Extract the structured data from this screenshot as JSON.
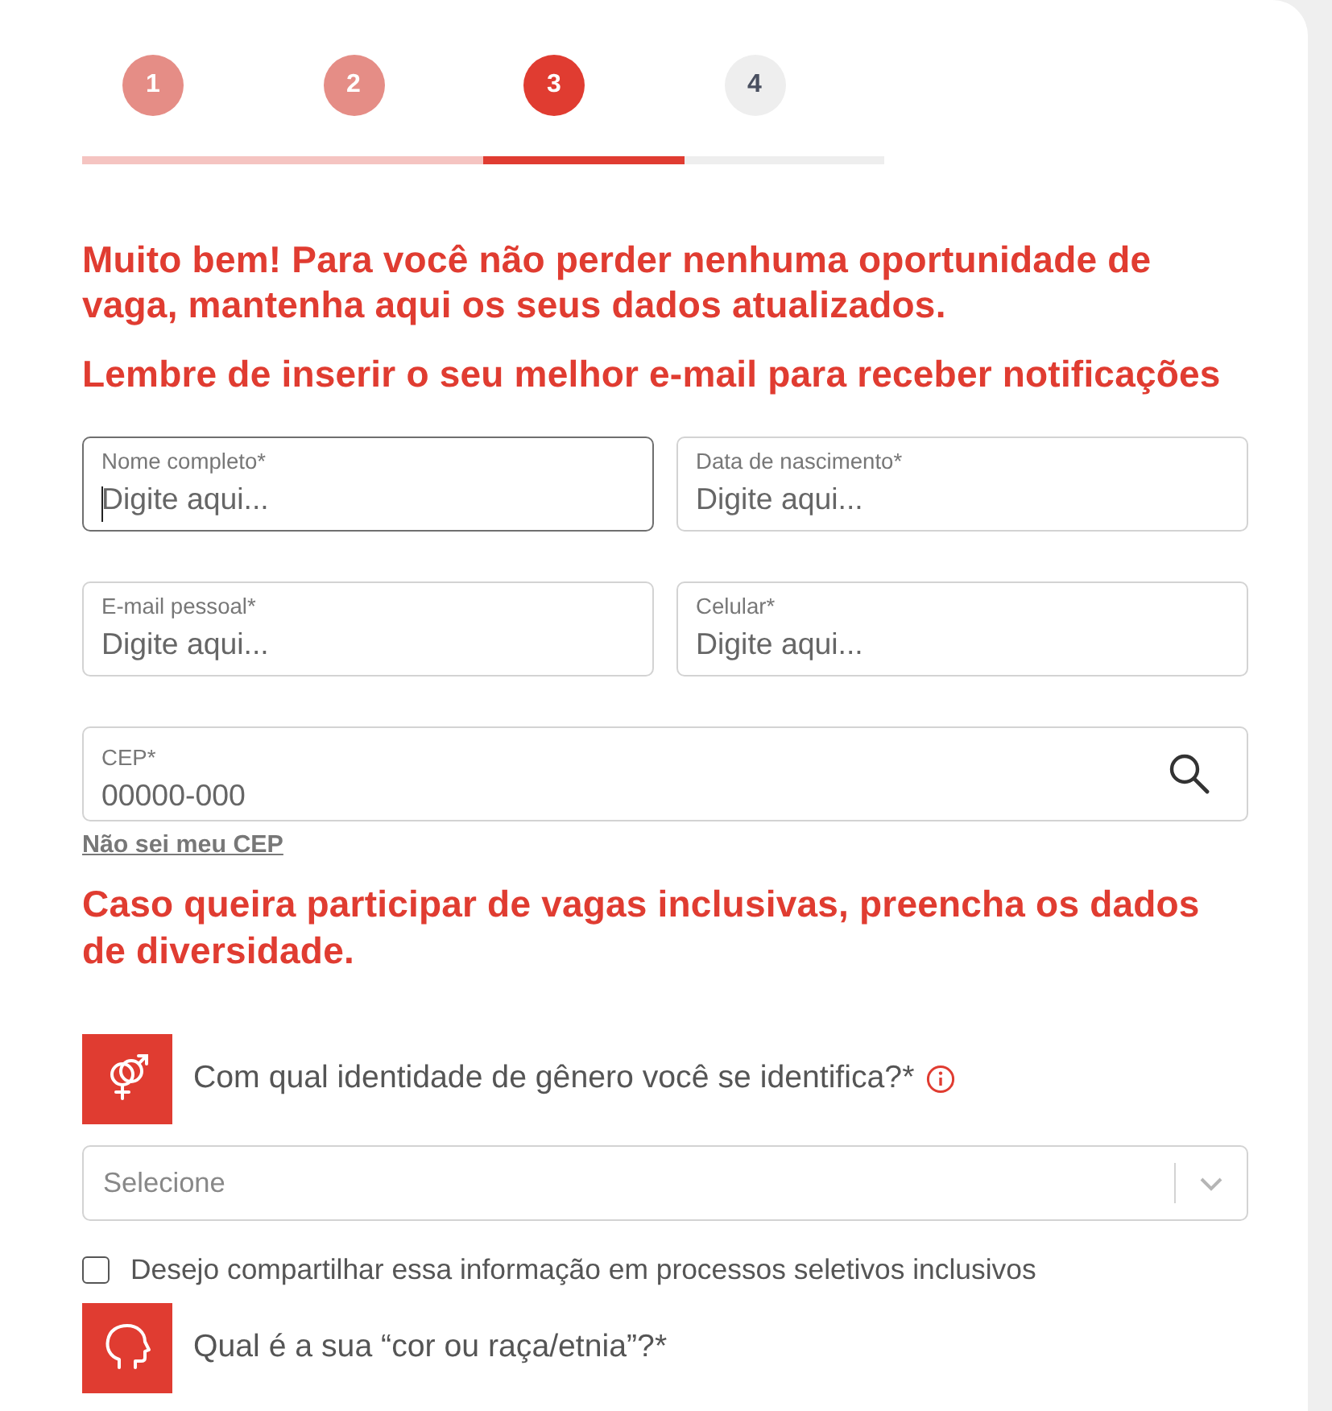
{
  "steps": [
    {
      "label": "1",
      "completed": true,
      "selected": false
    },
    {
      "label": "2",
      "completed": true,
      "selected": false
    },
    {
      "label": "3",
      "completed": false,
      "selected": true
    },
    {
      "label": "4",
      "completed": false,
      "selected": false
    }
  ],
  "intro": [
    "Muito bem! Para você não perder nenhuma oportunidade de vaga, mantenha aqui os seus dados atualizados.",
    "Lembre de inserir o seu melhor e-mail para receber notificações"
  ],
  "fields": [
    {
      "label": "Nome completo*",
      "placeholder": "Digite aqui...",
      "focused": true
    },
    {
      "label": "Data de nascimento*",
      "placeholder": "Digite aqui...",
      "focused": false
    },
    {
      "label": "E-mail pessoal*",
      "placeholder": "Digite aqui...",
      "focused": false
    },
    {
      "label": "Celular*",
      "placeholder": "Digite aqui...",
      "focused": false
    }
  ],
  "cep": {
    "label": "CEP*",
    "placeholder": "00000-000",
    "help_link": "Não sei meu CEP"
  },
  "diversity": {
    "heading": "Caso queira participar de vagas inclusivas, preencha os dados de diversidade.",
    "gender_question": "Com qual identidade de gênero você se identifica?*",
    "gender_select": {
      "placeholder": "Selecione"
    },
    "share_checkbox": {
      "label": "Desejo compartilhar essa informação em processos seletivos inclusivos",
      "checked": false
    },
    "race_question": "Qual é a sua “cor ou raça/etnia”?*"
  }
}
